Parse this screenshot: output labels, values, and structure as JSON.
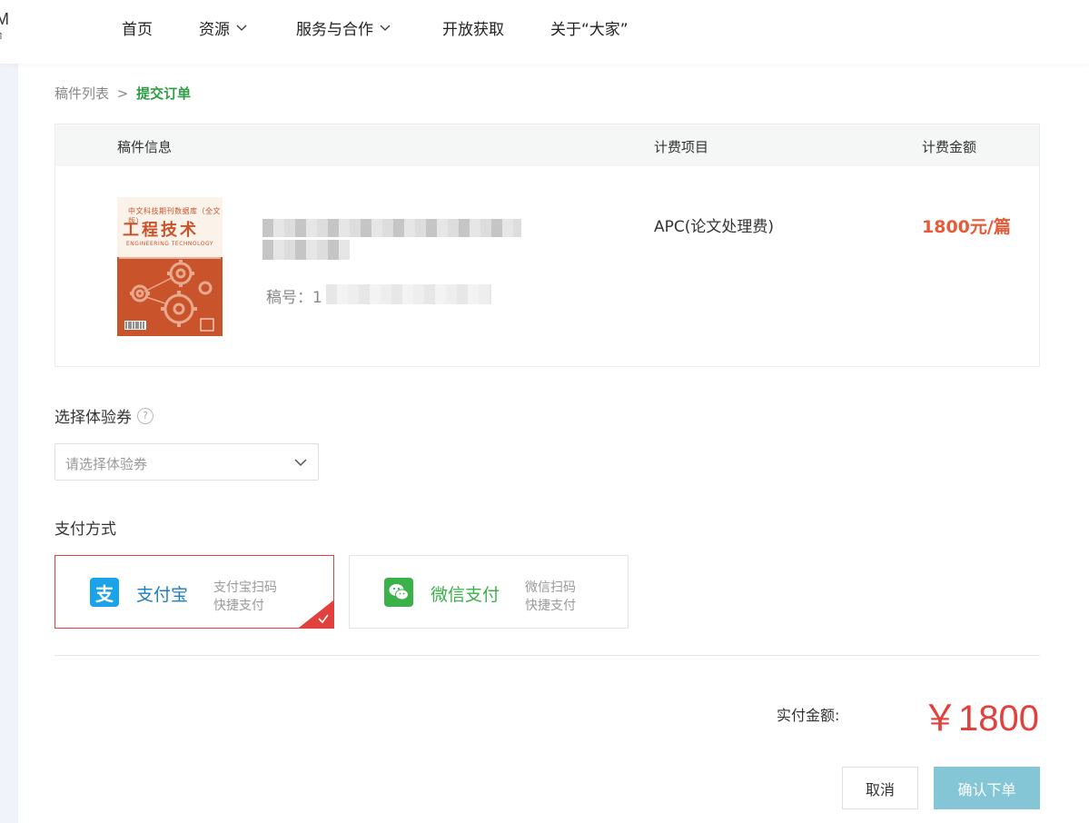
{
  "nav": {
    "logo_letter": "M",
    "logo_sub": "台",
    "items": [
      {
        "label": "首页",
        "has_dropdown": false
      },
      {
        "label": "资源",
        "has_dropdown": true
      },
      {
        "label": "服务与合作",
        "has_dropdown": true
      },
      {
        "label": "开放获取",
        "has_dropdown": false
      },
      {
        "label": "关于“大家”",
        "has_dropdown": false
      }
    ]
  },
  "breadcrumb": {
    "parent": "稿件列表",
    "separator": ">",
    "current": "提交订单"
  },
  "order_table": {
    "headers": {
      "info": "稿件信息",
      "fee_item": "计费项目",
      "fee_amount": "计费金额"
    },
    "row": {
      "cover": {
        "top_line": "中文科技期刊数据库（全文版）",
        "title": "工程技术",
        "subtitle": "ENGINEERING TECHNOLOGY"
      },
      "manuscript_label": "稿号：1",
      "fee_item": "APC(论文处理费)",
      "fee_amount": "1800元/篇"
    }
  },
  "coupon": {
    "title": "选择体验券",
    "help_symbol": "?",
    "placeholder": "请选择体验券"
  },
  "payment": {
    "title": "支付方式",
    "methods": [
      {
        "name": "支付宝",
        "icon_glyph": "支",
        "desc_line1": "支付宝扫码",
        "desc_line2": "快捷支付",
        "selected": true,
        "color": "#1aa3e8"
      },
      {
        "name": "微信支付",
        "icon_glyph": "",
        "desc_line1": "微信扫码",
        "desc_line2": "快捷支付",
        "selected": false,
        "color": "#3bb14a"
      }
    ]
  },
  "summary": {
    "label": "实付金额:",
    "amount": "￥1800"
  },
  "actions": {
    "cancel": "取消",
    "confirm": "确认下单"
  },
  "colors": {
    "accent_red": "#e2403c",
    "fee_orange": "#e65a38",
    "breadcrumb_green": "#2e9d43",
    "confirm_button": "#84c6d6"
  }
}
